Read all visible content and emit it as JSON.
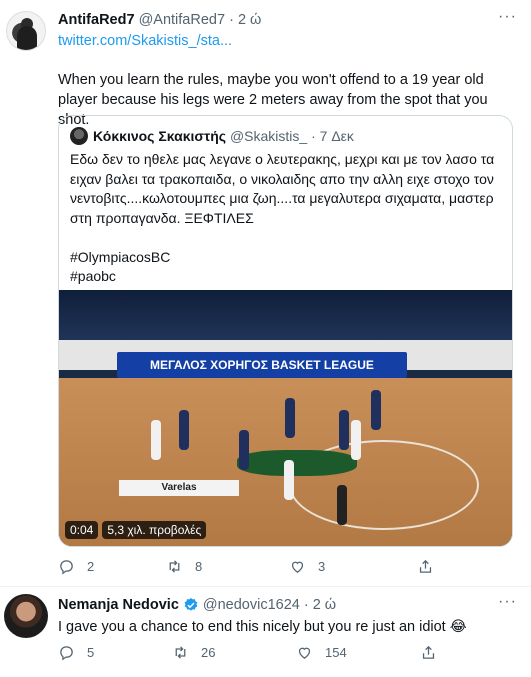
{
  "tweet1": {
    "name": "AntifaRed7",
    "handle": "@AntifaRed7",
    "dot": "·",
    "time": "2 ώ",
    "link": "twitter.com/Skakistis_/sta...",
    "more": "···",
    "text": "When you learn the rules, maybe you won't offend to a 19 year old player because his legs were 2 meters away from the spot that you shot.",
    "quote": {
      "name": "Κόκκινος Σκακιστής",
      "handle": "@Skakistis_",
      "dot": "·",
      "time": "7 Δεκ",
      "text": "Εδω δεν το ηθελε μας λεγανε ο λευτερακης, μεχρι και με τον λασο τα ειχαν βαλει τα τρακοπαιδα, ο νικολαιδης απο την αλλη ειχε στοχο τον νεντοβιτς....κωλοτουμπες μια ζωη....τα μεγαλυτερα σιχαματα, μαστερ στη προπαγανδα. ΞΕΦΤΙΛΕΣ",
      "hashtag1": "#OlympiacosBC",
      "hashtag2": "#paobc",
      "video": {
        "duration": "0:04",
        "views": "5,3 χιλ. προβολές",
        "banner": "ΜΕΓΑΛΟΣ ΧΟΡΗΓΟΣ BASKET LEAGUE",
        "sponsor": "Varelas"
      }
    },
    "actions": {
      "replies": "2",
      "retweets": "8",
      "likes": "3"
    }
  },
  "tweet2": {
    "name": "Nemanja Nedovic",
    "handle": "@nedovic1624",
    "dot": "·",
    "time": "2 ώ",
    "more": "···",
    "text": "I gave you a chance to end this nicely but you re just an idiot 😂",
    "actions": {
      "replies": "5",
      "retweets": "26",
      "likes": "154"
    }
  },
  "colors": {
    "accent": "#1d9bf0",
    "muted": "#536471",
    "text": "#0f1419",
    "border": "#cfd9de"
  }
}
